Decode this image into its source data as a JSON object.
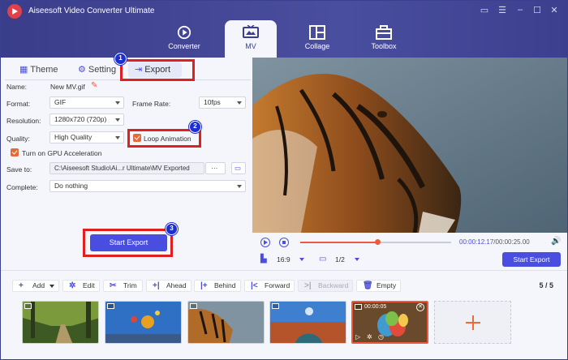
{
  "app": {
    "title": "Aiseesoft Video Converter Ultimate"
  },
  "nav": {
    "tabs": [
      {
        "label": "Converter",
        "icon": "refresh-circle-icon"
      },
      {
        "label": "MV",
        "icon": "tv-icon",
        "active": true
      },
      {
        "label": "Collage",
        "icon": "collage-grid-icon"
      },
      {
        "label": "Toolbox",
        "icon": "toolbox-icon"
      }
    ]
  },
  "subtabs": {
    "theme": "Theme",
    "setting": "Setting",
    "export": "Export"
  },
  "form": {
    "name_label": "Name:",
    "name_value": "New MV.gif",
    "format_label": "Format:",
    "format_value": "GIF",
    "framerate_label": "Frame Rate:",
    "framerate_value": "10fps",
    "resolution_label": "Resolution:",
    "resolution_value": "1280x720 (720p)",
    "quality_label": "Quality:",
    "quality_value": "High Quality",
    "loop_label": "Loop Animation",
    "gpu_label": "Turn on GPU Acceleration",
    "saveto_label": "Save to:",
    "saveto_value": "C:\\Aiseesoft Studio\\Ai...r Ultimate\\MV Exported",
    "saveto_more": "···",
    "complete_label": "Complete:",
    "complete_value": "Do nothing",
    "start_export": "Start Export"
  },
  "badges": [
    "1",
    "2",
    "3"
  ],
  "player": {
    "current_time": "00:00:12.17",
    "total_time": "/00:00:25.00",
    "progress": 0.51,
    "aspect": "16:9",
    "page": "1/2",
    "start_export": "Start Export"
  },
  "toolbar": {
    "add": "Add",
    "edit": "Edit",
    "trim": "Trim",
    "ahead": "Ahead",
    "behind": "Behind",
    "forward": "Forward",
    "backward": "Backward",
    "empty": "Empty",
    "counter": "5 / 5"
  },
  "timeline": {
    "selected_duration": "00:00:05",
    "clips": [
      "forest-path",
      "hot-air-balloons",
      "tiger",
      "canyon",
      "colorful-eggs"
    ]
  },
  "colors": {
    "accent": "#4a4ee0",
    "header": "#3b3f8f",
    "highlight": "#f05a3c",
    "annotation": "#e02020"
  }
}
